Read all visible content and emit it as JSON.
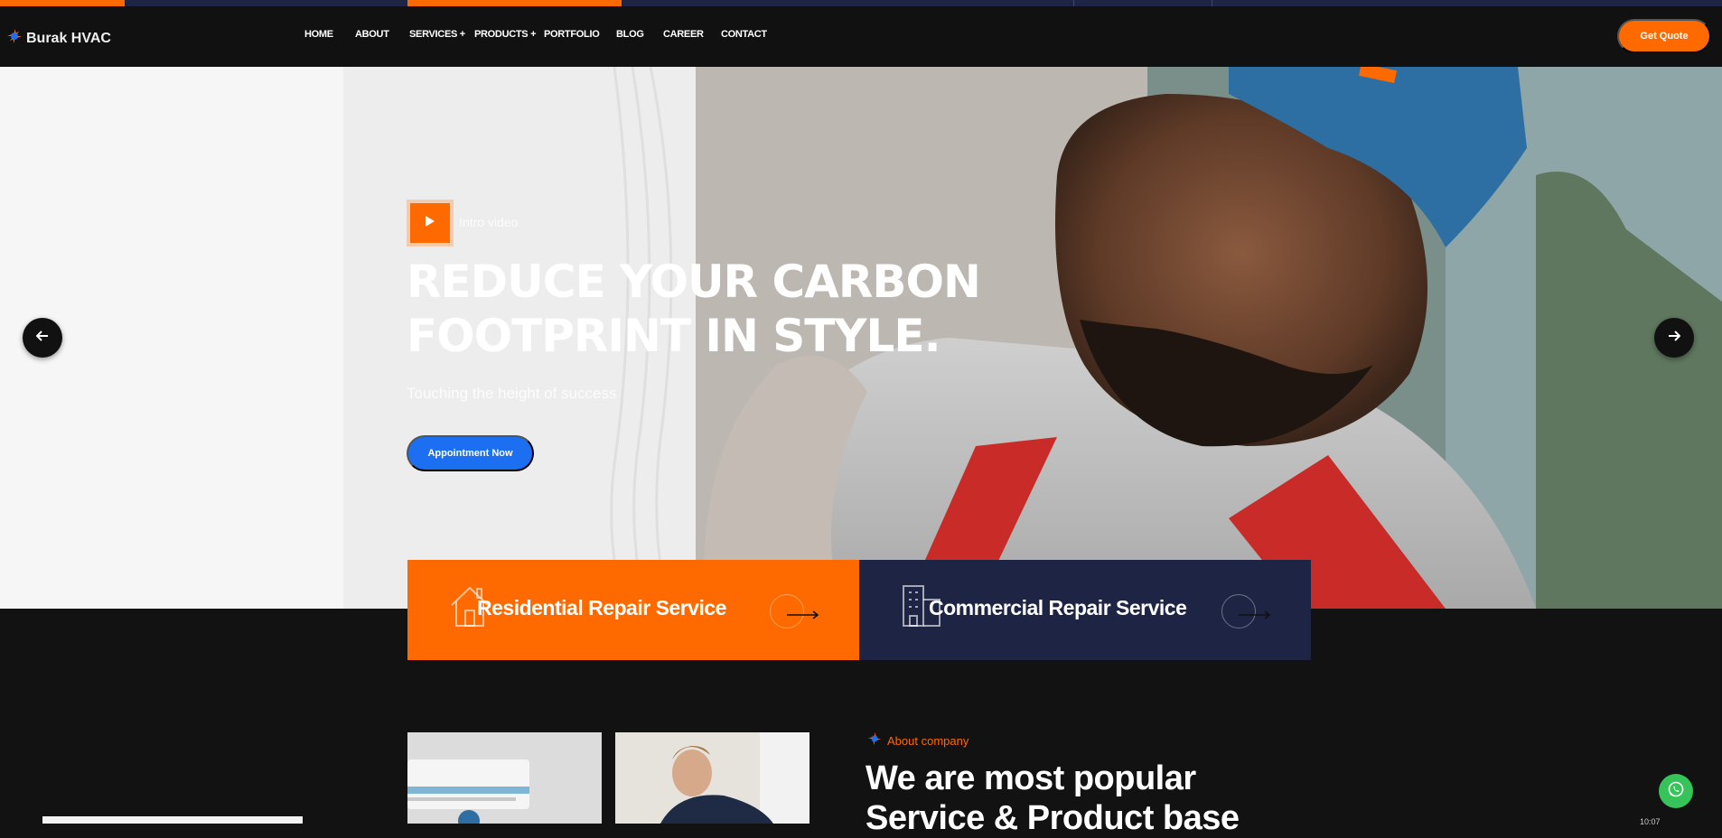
{
  "brand": {
    "name": "Burak HVAC"
  },
  "nav": {
    "items": [
      {
        "label": "HOME"
      },
      {
        "label": "ABOUT"
      },
      {
        "label": "SERVICES",
        "has_submenu": true
      },
      {
        "label": "PRODUCTS",
        "has_submenu": true
      },
      {
        "label": "PORTFOLIO"
      },
      {
        "label": "BLOG"
      },
      {
        "label": "CAREER"
      },
      {
        "label": "CONTACT"
      }
    ],
    "quote_label": "Get Quote"
  },
  "hero": {
    "video_label": "Intro video",
    "headline": "REDUCE YOUR CARBON FOOTPRINT IN STYLE.",
    "subline": "Touching the height of success",
    "cta_label": "Appointment Now",
    "prev_icon": "arrow-left-icon",
    "next_icon": "arrow-right-icon"
  },
  "services": [
    {
      "title": "Residential Repair Service",
      "icon": "house-icon",
      "bg": "#ff6a00"
    },
    {
      "title": "Commercial Repair Service",
      "icon": "building-icon",
      "bg": "#1e2544"
    }
  ],
  "about": {
    "tag": "About company",
    "heading": "We are most popular Service & Product base"
  },
  "colors": {
    "accent": "#ff6a00",
    "navy": "#1e2544",
    "blue": "#1d6ff2",
    "dark": "#121212",
    "whatsapp": "#35c35a"
  },
  "clock": "10:07"
}
